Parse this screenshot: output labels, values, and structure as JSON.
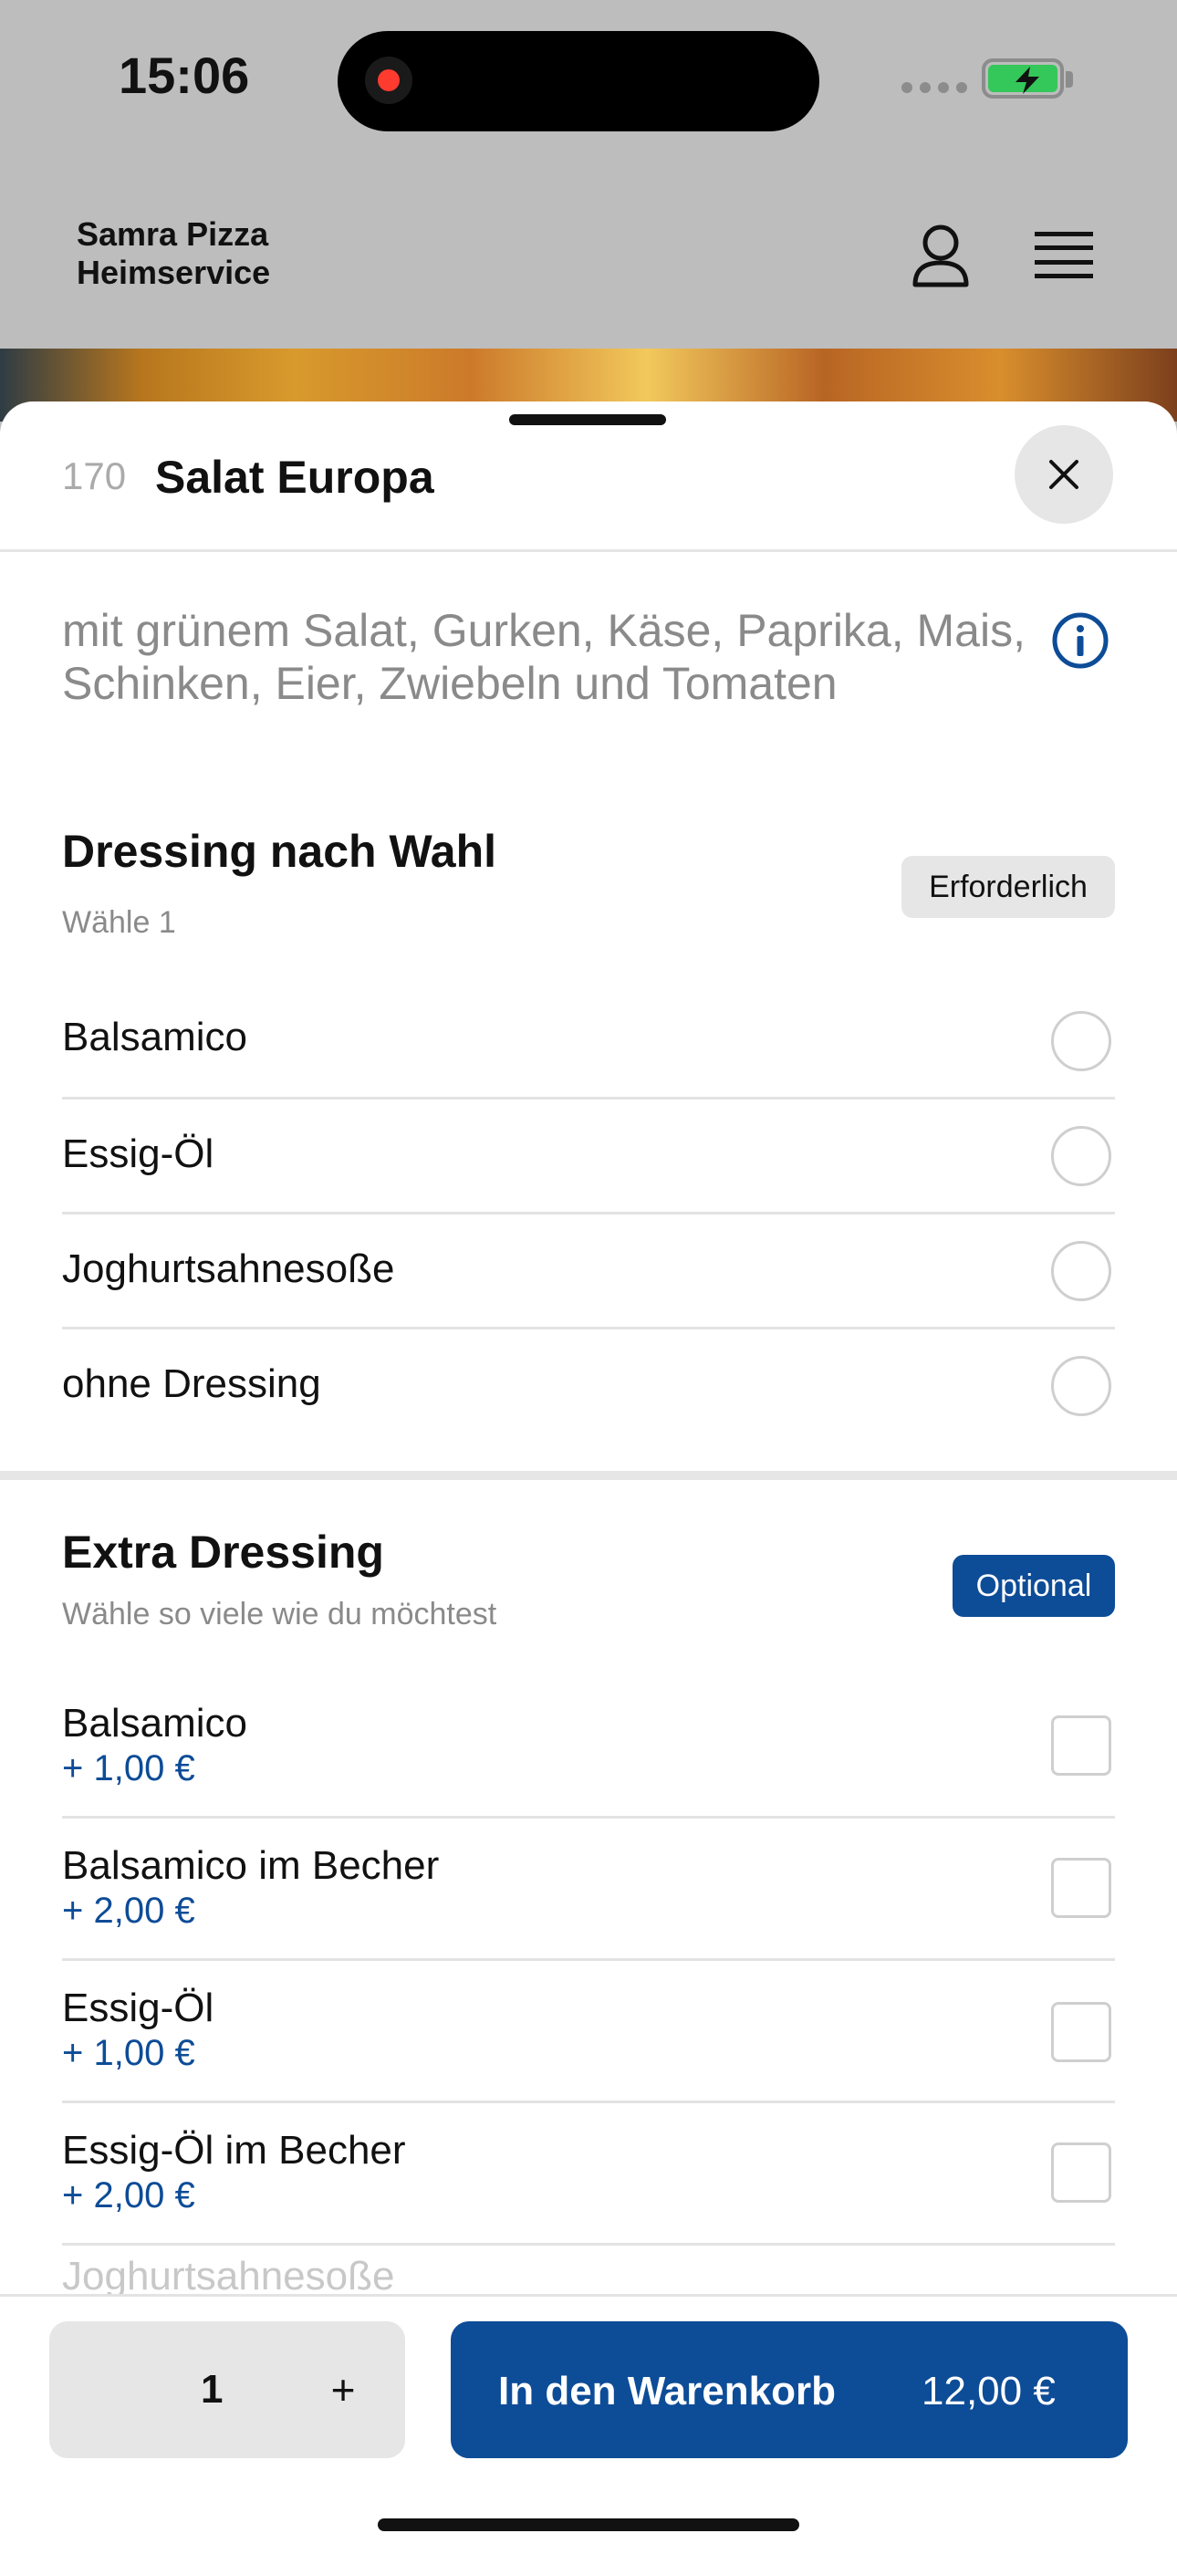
{
  "status_bar": {
    "time": "15:06",
    "battery_charging": true
  },
  "header": {
    "brand_line1": "Samra Pizza",
    "brand_line2": "Heimservice",
    "user_icon": "user-icon",
    "menu_icon": "menu-icon"
  },
  "item": {
    "number": "170",
    "title": "Salat Europa",
    "description": "mit grünem Salat, Gurken, Käse, Paprika, Mais, Schinken, Eier, Zwiebeln und Tomaten"
  },
  "dressing_section": {
    "title": "Dressing nach Wahl",
    "subtitle": "Wähle 1",
    "badge": "Erforderlich",
    "options": [
      {
        "label": "Balsamico"
      },
      {
        "label": "Essig-Öl"
      },
      {
        "label": "Joghurtsahnesoße"
      },
      {
        "label": "ohne Dressing"
      }
    ]
  },
  "extra_section": {
    "title": "Extra Dressing",
    "subtitle": "Wähle so viele wie du möchtest",
    "badge": "Optional",
    "options": [
      {
        "label": "Balsamico",
        "price": "+ 1,00 €"
      },
      {
        "label": "Balsamico im Becher",
        "price": "+ 2,00 €"
      },
      {
        "label": "Essig-Öl",
        "price": "+ 1,00 €"
      },
      {
        "label": "Essig-Öl im Becher",
        "price": "+ 2,00 €"
      },
      {
        "label": "Joghurtsahnesoße"
      }
    ]
  },
  "footer": {
    "quantity": "1",
    "plus_label": "+",
    "cart_label": "In den Warenkorb",
    "cart_price": "12,00 €"
  },
  "colors": {
    "accent": "#0d4c97",
    "badge_gray": "#e6e6e6",
    "muted_text": "#8a8a8a"
  }
}
